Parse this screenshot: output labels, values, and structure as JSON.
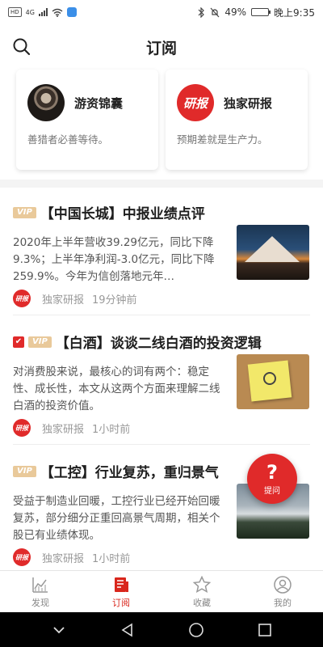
{
  "status_bar": {
    "hd_tag": "HD",
    "network": "4G",
    "battery_percent": "49%",
    "battery_level": 0.49,
    "time": "晚上9:35"
  },
  "header": {
    "title": "订阅",
    "search_icon": "search-icon"
  },
  "channels": [
    {
      "name": "游资锦囊",
      "desc": "善猎者必善等待。",
      "avatar": "photo-avatar"
    },
    {
      "name": "独家研报",
      "desc": "预期差就是生产力。",
      "avatar_text": "研报"
    }
  ],
  "articles": [
    {
      "hot": false,
      "vip_label": "VIP",
      "title": "【中国长城】中报业绩点评",
      "body": "2020年上半年营收39.29亿元，同比下降9.3%；上半年净利润-3.0亿元，同比下降259.9%。今年为信创落地元年…",
      "source_logo": "研报",
      "source": "独家研报",
      "time": "19分钟前",
      "thumb": "mountain-image"
    },
    {
      "hot": true,
      "hot_label": "✔",
      "vip_label": "VIP",
      "title": "【白酒】谈谈二线白酒的投资逻辑",
      "body": "对消费股来说，最核心的词有两个：稳定性、成长性，本文从这两个方面来理解二线白酒的投资价值。",
      "source_logo": "研报",
      "source": "独家研报",
      "time": "1小时前",
      "thumb": "lightbulb-note-image"
    },
    {
      "hot": false,
      "vip_label": "VIP",
      "title": "【工控】行业复苏，重归景气",
      "body": "受益于制造业回暖，工控行业已经开始回暖复苏，部分细分正重回高景气周期，相关个股已有业绩体现。",
      "source_logo": "研报",
      "source": "独家研报",
      "time": "1小时前",
      "thumb": "cloud-sea-image"
    }
  ],
  "ask_button": {
    "symbol": "?",
    "label": "提问",
    "color": "#e02a2a"
  },
  "bottom_nav": [
    {
      "label": "发现",
      "icon": "chart-icon",
      "active": false
    },
    {
      "label": "订阅",
      "icon": "news-icon",
      "active": true
    },
    {
      "label": "收藏",
      "icon": "star-icon",
      "active": false
    },
    {
      "label": "我的",
      "icon": "user-icon",
      "active": false
    }
  ],
  "colors": {
    "accent": "#d9261c",
    "vip": "#e9c99a"
  }
}
